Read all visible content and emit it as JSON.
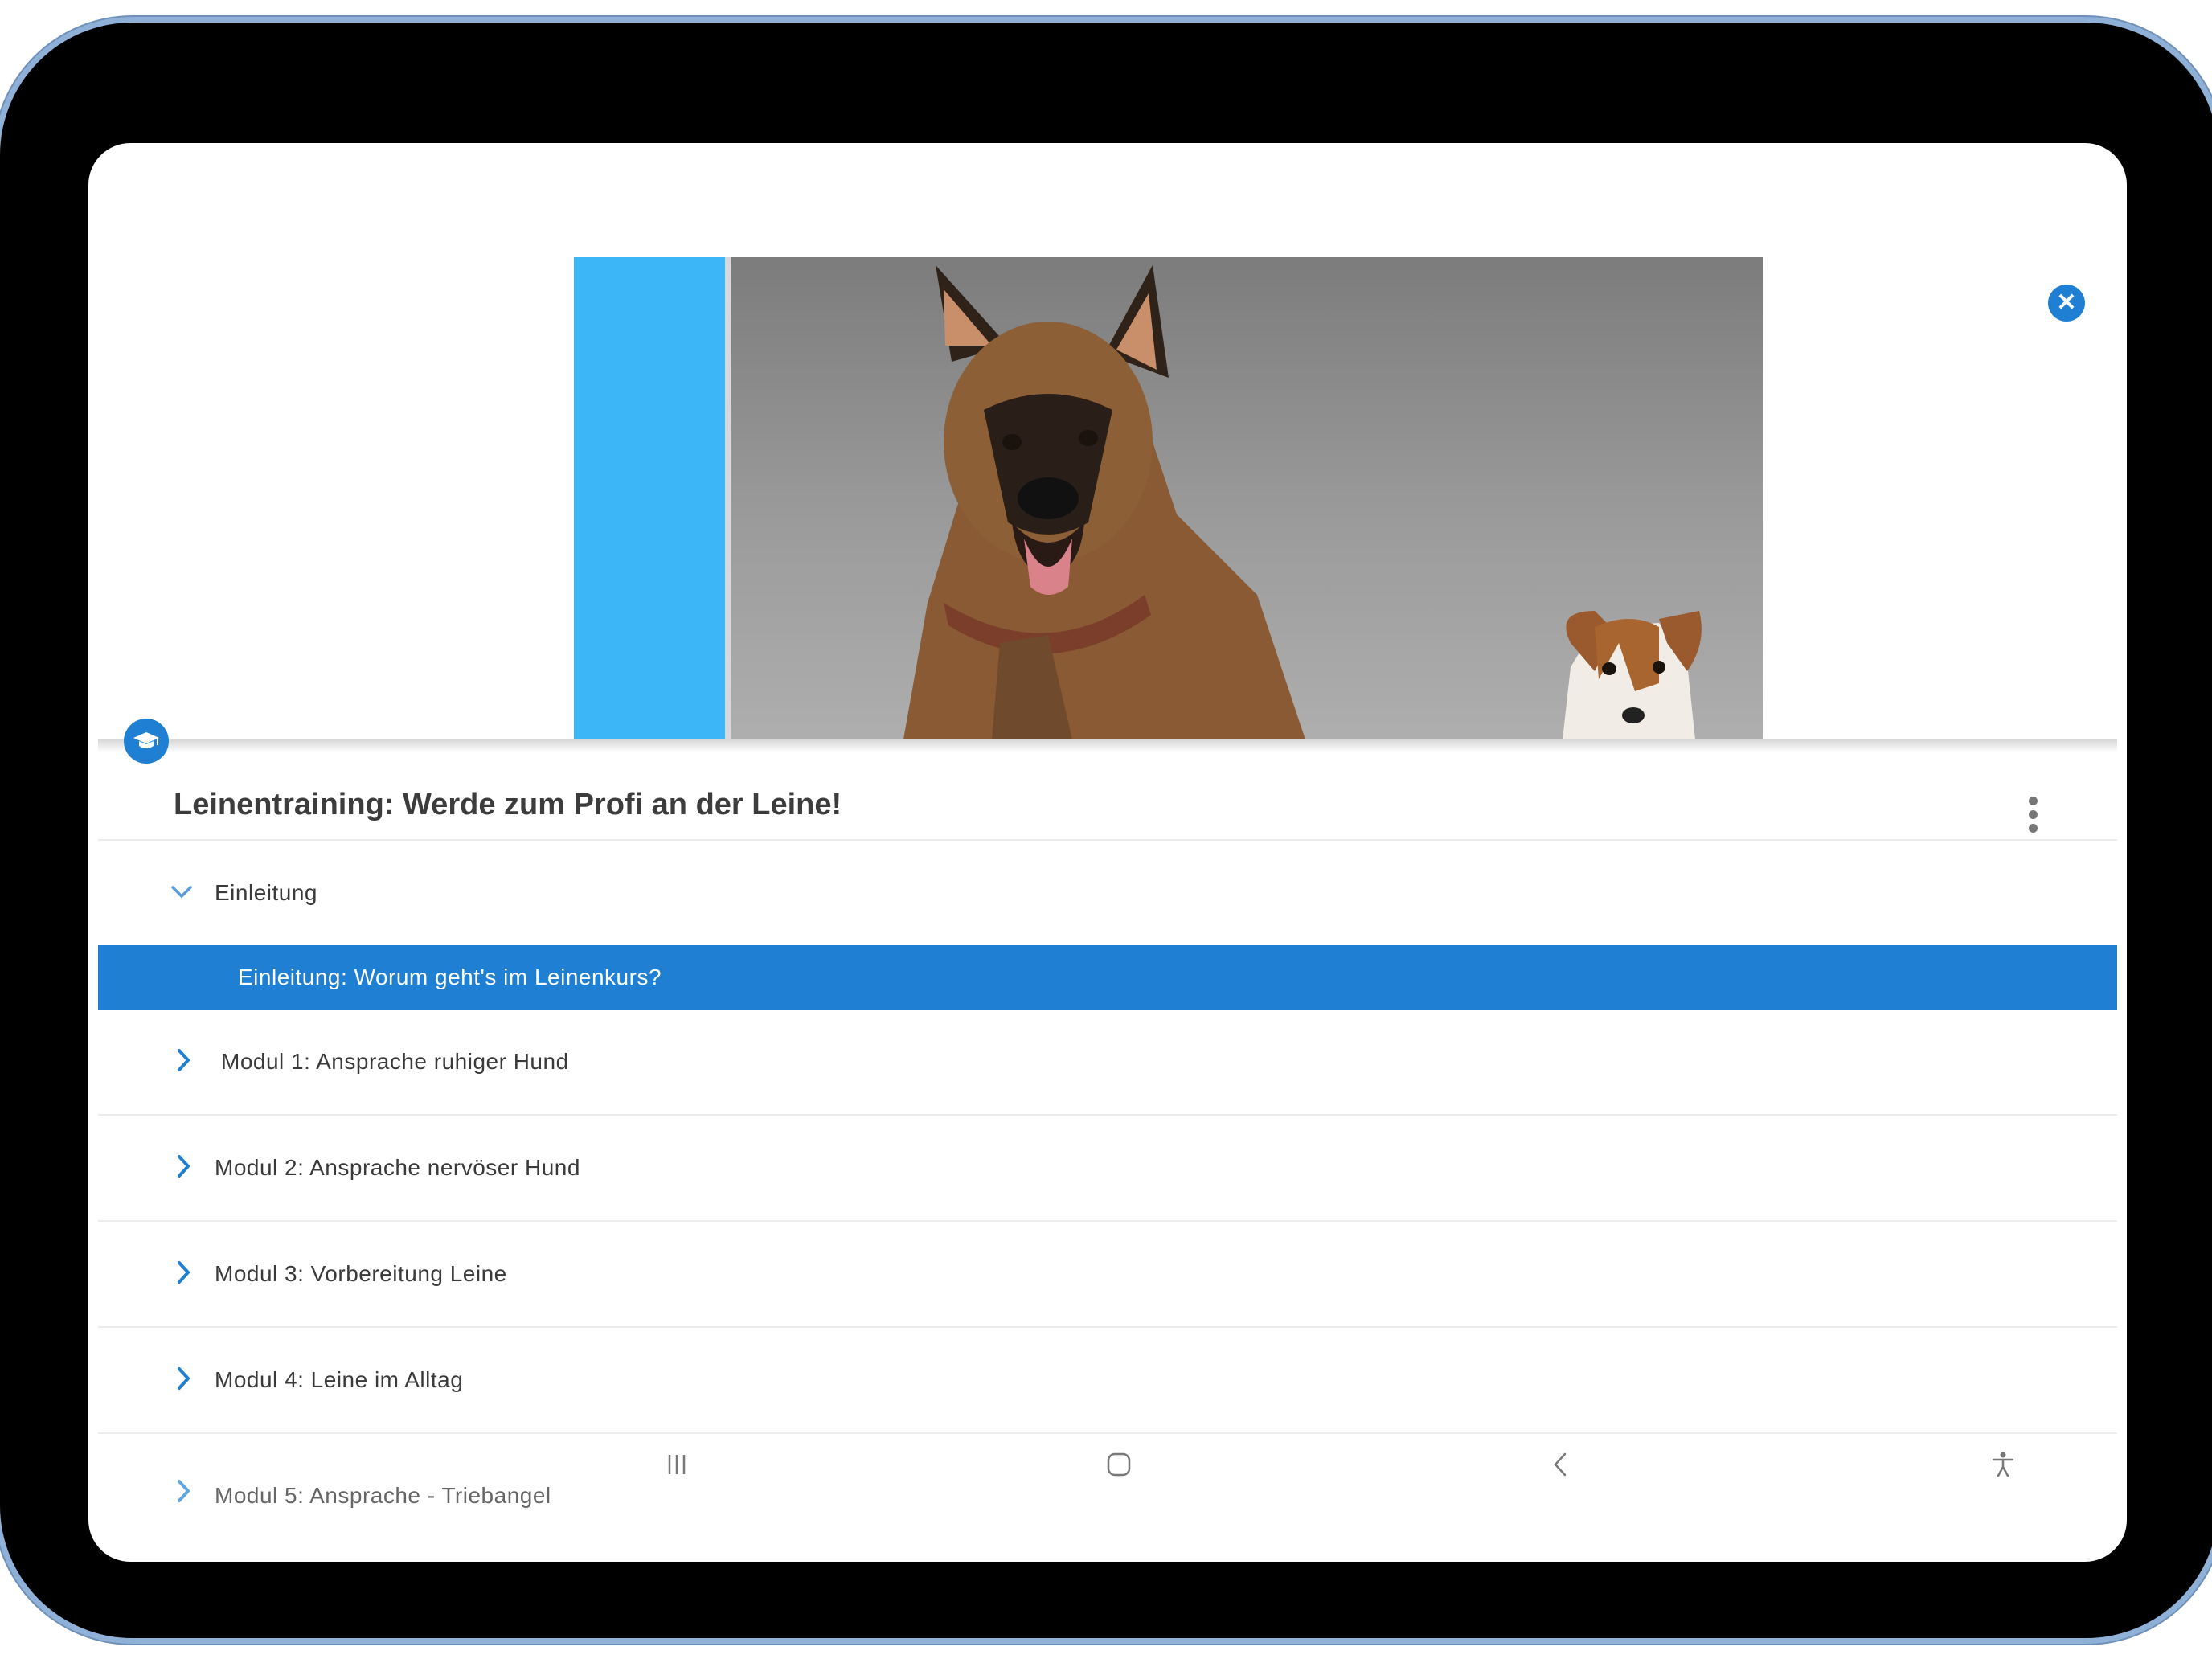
{
  "course": {
    "title": "Leinentraining: Werde zum Profi an der Leine!"
  },
  "sections": [
    {
      "label": "Einleitung",
      "expanded": true,
      "lessons": [
        {
          "label": "Einleitung: Worum geht's im Leinenkurs?",
          "active": true
        }
      ]
    },
    {
      "label": "Modul 1: Ansprache ruhiger Hund",
      "expanded": false
    },
    {
      "label": "Modul 2: Ansprache nervöser Hund",
      "expanded": false
    },
    {
      "label": "Modul 3: Vorbereitung Leine",
      "expanded": false
    },
    {
      "label": "Modul 4: Leine im Alltag",
      "expanded": false
    },
    {
      "label": "Modul 5: Ansprache - Triebangel",
      "expanded": false
    }
  ],
  "icons": {
    "close": "close-icon",
    "course_badge": "graduation-cap-icon",
    "more": "more-vertical-icon",
    "expanded": "chevron-down-icon",
    "collapsed": "chevron-right-icon",
    "nav_recents": "recents-icon",
    "nav_home": "home-icon",
    "nav_back": "back-icon",
    "nav_accessibility": "accessibility-icon"
  },
  "colors": {
    "accent": "#1e7fd3",
    "hero_blue": "#3cb6f7",
    "text": "#3a3a3a",
    "frame": "#000000",
    "frame_border": "#8fb1d8"
  }
}
